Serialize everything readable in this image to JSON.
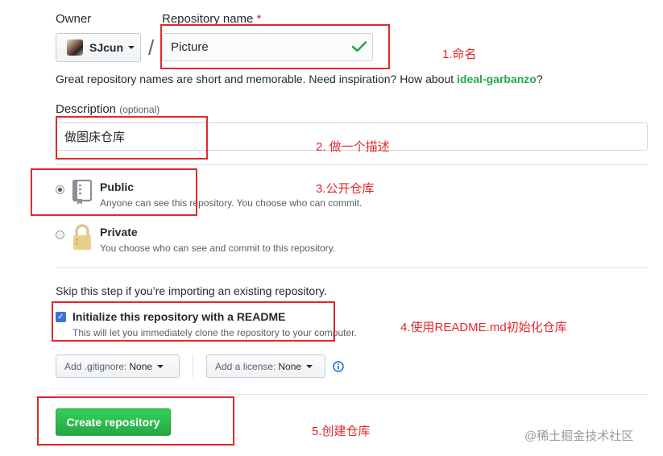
{
  "owner": {
    "label": "Owner",
    "name": "SJcun"
  },
  "repo": {
    "label": "Repository name",
    "required_mark": "*",
    "value": "Picture",
    "separator": "/"
  },
  "name_hint": {
    "text": "Great repository names are short and memorable. Need inspiration? How about ",
    "suggestion": "ideal-garbanzo",
    "suffix": "?"
  },
  "description": {
    "label": "Description",
    "optional": "(optional)",
    "value": "做图床仓库"
  },
  "visibility": {
    "public": {
      "title": "Public",
      "desc": "Anyone can see this repository. You choose who can commit.",
      "selected": true
    },
    "private": {
      "title": "Private",
      "desc": "You choose who can see and commit to this repository.",
      "selected": false
    }
  },
  "import_note": "Skip this step if you’re importing an existing repository.",
  "readme": {
    "title": "Initialize this repository with a README",
    "desc": "This will let you immediately clone the repository to your computer.",
    "checked": true
  },
  "gitignore": {
    "label": "Add .gitignore:",
    "value": "None"
  },
  "license": {
    "label": "Add a license:",
    "value": "None"
  },
  "submit": {
    "label": "Create repository"
  },
  "annotations": {
    "a1": "1.命名",
    "a2": "2. 做一个描述",
    "a3": "3.公开仓库",
    "a4": "4.使用README.md初始化仓库",
    "a5": "5.创建仓库"
  },
  "watermark": "@稀土掘金技术社区",
  "colors": {
    "accent_green": "#28a745",
    "annotation_red": "#e0292b",
    "info_blue": "#0366d6"
  }
}
